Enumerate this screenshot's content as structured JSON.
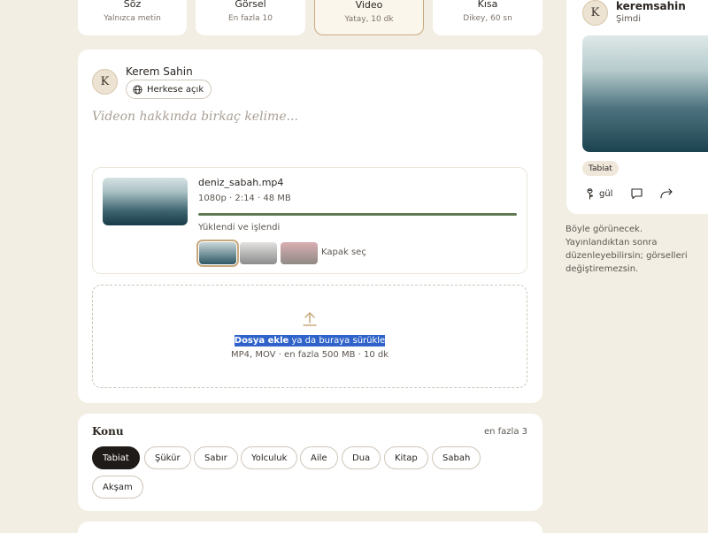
{
  "types": [
    {
      "label": "Söz",
      "sub": "Yalnızca metin"
    },
    {
      "label": "Görsel",
      "sub": "En fazla 10"
    },
    {
      "label": "Video",
      "sub": "Yatay, 10 dk"
    },
    {
      "label": "Kısa",
      "sub": "Dikey, 60 sn"
    }
  ],
  "composer": {
    "avatar_initial": "K",
    "author": "Kerem Sahin",
    "visibility": "Herkese açık",
    "caption_placeholder": "Videon hakkında birkaç kelime..."
  },
  "upload": {
    "filename": "deniz_sabah.mp4",
    "meta": "1080p · 2:14 · 48 MB",
    "progress": 1.0,
    "status": "Yüklendi ve işlendi",
    "cover_label": "Kapak seç",
    "covers": [
      {
        "colors": [
          "#c9d8d9",
          "#2d5865"
        ],
        "selected": true
      },
      {
        "colors": [
          "#e3e2e0",
          "#8b8c8c"
        ],
        "selected": false
      },
      {
        "colors": [
          "#d9aeb2",
          "#8f8a85"
        ],
        "selected": false
      }
    ],
    "progress_color": "#5f7a52"
  },
  "dropzone": {
    "link": "Dosya ekle",
    "rest": " ya da buraya sürükle",
    "sub": "MP4, MOV · en fazla 500 MB · 10 dk"
  },
  "topics": {
    "title": "Konu",
    "max": "en fazla 3",
    "items": [
      {
        "label": "Tabiat",
        "active": true
      },
      {
        "label": "Şükür",
        "active": false
      },
      {
        "label": "Sabır",
        "active": false
      },
      {
        "label": "Yolculuk",
        "active": false
      },
      {
        "label": "Aile",
        "active": false
      },
      {
        "label": "Dua",
        "active": false
      },
      {
        "label": "Kitap",
        "active": false
      },
      {
        "label": "Sabah",
        "active": false
      },
      {
        "label": "Akşam",
        "active": false
      }
    ]
  },
  "preview": {
    "avatar_initial": "K",
    "username": "keremsahin",
    "time": "Şimdi",
    "tag": "Tabiat",
    "like_label": "gül",
    "note": "Böyle görünecek. Yayınlandıktan sonra düzenleyebilirsin; görselleri değiştiremezsin."
  },
  "colors": {
    "accent": "#c9a97e",
    "background": "#f3eee4",
    "highlight": "#2f63c9"
  }
}
